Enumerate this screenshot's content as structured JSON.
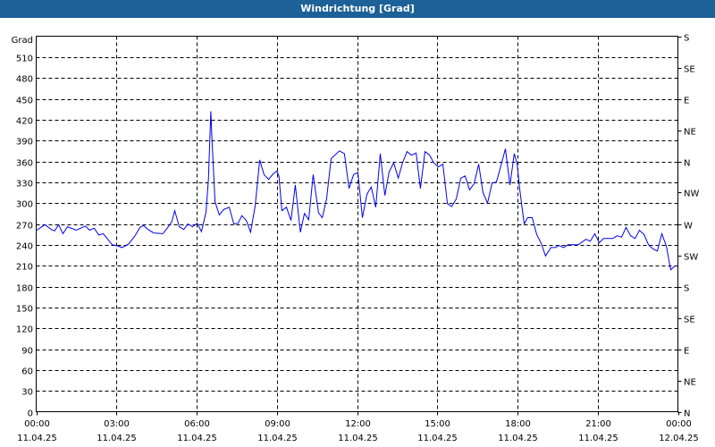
{
  "window": {
    "title": "Windrichtung [Grad]"
  },
  "chart_data": {
    "type": "line",
    "title": "Windrichtung [Grad]",
    "ylabel": "Grad",
    "ylim": [
      0,
      540
    ],
    "yticks": [
      0,
      30,
      60,
      90,
      120,
      150,
      180,
      210,
      240,
      270,
      300,
      330,
      360,
      390,
      420,
      450,
      480,
      510
    ],
    "right_axis": [
      {
        "value": 540,
        "label": "S"
      },
      {
        "value": 495,
        "label": "SE"
      },
      {
        "value": 450,
        "label": "E"
      },
      {
        "value": 405,
        "label": "NE"
      },
      {
        "value": 360,
        "label": "N"
      },
      {
        "value": 315,
        "label": "NW"
      },
      {
        "value": 270,
        "label": "W"
      },
      {
        "value": 225,
        "label": "SW"
      },
      {
        "value": 180,
        "label": "S"
      },
      {
        "value": 135,
        "label": "SE"
      },
      {
        "value": 90,
        "label": "E"
      },
      {
        "value": 45,
        "label": "NE"
      },
      {
        "value": 0,
        "label": "N"
      }
    ],
    "xlim_hours": [
      0,
      24
    ],
    "xticks": [
      {
        "hour": 0,
        "time": "00:00",
        "date": "11.04.25"
      },
      {
        "hour": 3,
        "time": "03:00",
        "date": "11.04.25"
      },
      {
        "hour": 6,
        "time": "06:00",
        "date": "11.04.25"
      },
      {
        "hour": 9,
        "time": "09:00",
        "date": "11.04.25"
      },
      {
        "hour": 12,
        "time": "12:00",
        "date": "11.04.25"
      },
      {
        "hour": 15,
        "time": "15:00",
        "date": "11.04.25"
      },
      {
        "hour": 18,
        "time": "18:00",
        "date": "11.04.25"
      },
      {
        "hour": 21,
        "time": "21:00",
        "date": "11.04.25"
      },
      {
        "hour": 24,
        "time": "00:00",
        "date": "12.04.25"
      }
    ],
    "grid": true,
    "series": [
      {
        "name": "Windrichtung",
        "color": "#0000ee",
        "points": [
          [
            0.02,
            261
          ],
          [
            0.33,
            269
          ],
          [
            0.56,
            262
          ],
          [
            0.69,
            260
          ],
          [
            0.84,
            269
          ],
          [
            1.0,
            256
          ],
          [
            1.17,
            266
          ],
          [
            1.5,
            261
          ],
          [
            1.84,
            267
          ],
          [
            2.0,
            261
          ],
          [
            2.17,
            264
          ],
          [
            2.34,
            254
          ],
          [
            2.51,
            256
          ],
          [
            2.84,
            240
          ],
          [
            3.01,
            239
          ],
          [
            3.21,
            236
          ],
          [
            3.45,
            241
          ],
          [
            3.68,
            252
          ],
          [
            3.88,
            265
          ],
          [
            4.01,
            268
          ],
          [
            4.18,
            262
          ],
          [
            4.4,
            257
          ],
          [
            4.74,
            256
          ],
          [
            4.9,
            264
          ],
          [
            5.07,
            273
          ],
          [
            5.18,
            289
          ],
          [
            5.35,
            266
          ],
          [
            5.52,
            262
          ],
          [
            5.68,
            270
          ],
          [
            5.85,
            266
          ],
          [
            6.02,
            271
          ],
          [
            6.18,
            259
          ],
          [
            6.35,
            287
          ],
          [
            6.44,
            334
          ],
          [
            6.53,
            432
          ],
          [
            6.57,
            394
          ],
          [
            6.69,
            302
          ],
          [
            6.85,
            283
          ],
          [
            7.02,
            291
          ],
          [
            7.22,
            294
          ],
          [
            7.39,
            270
          ],
          [
            7.55,
            271
          ],
          [
            7.69,
            282
          ],
          [
            7.86,
            275
          ],
          [
            8.02,
            258
          ],
          [
            8.19,
            296
          ],
          [
            8.36,
            362
          ],
          [
            8.52,
            341
          ],
          [
            8.69,
            334
          ],
          [
            8.86,
            342
          ],
          [
            9.0,
            346
          ],
          [
            9.08,
            339
          ],
          [
            9.19,
            289
          ],
          [
            9.36,
            294
          ],
          [
            9.53,
            275
          ],
          [
            9.69,
            326
          ],
          [
            9.88,
            258
          ],
          [
            10.03,
            285
          ],
          [
            10.19,
            276
          ],
          [
            10.36,
            341
          ],
          [
            10.56,
            286
          ],
          [
            10.7,
            279
          ],
          [
            10.86,
            306
          ],
          [
            11.03,
            364
          ],
          [
            11.34,
            375
          ],
          [
            11.53,
            371
          ],
          [
            11.7,
            321
          ],
          [
            11.87,
            341
          ],
          [
            12.03,
            344
          ],
          [
            12.2,
            279
          ],
          [
            12.37,
            313
          ],
          [
            12.53,
            323
          ],
          [
            12.7,
            294
          ],
          [
            12.87,
            371
          ],
          [
            13.04,
            311
          ],
          [
            13.2,
            345
          ],
          [
            13.37,
            358
          ],
          [
            13.54,
            336
          ],
          [
            13.7,
            358
          ],
          [
            13.87,
            374
          ],
          [
            14.04,
            369
          ],
          [
            14.21,
            372
          ],
          [
            14.37,
            321
          ],
          [
            14.54,
            374
          ],
          [
            14.71,
            369
          ],
          [
            14.87,
            358
          ],
          [
            15.04,
            352
          ],
          [
            15.21,
            356
          ],
          [
            15.38,
            299
          ],
          [
            15.54,
            295
          ],
          [
            15.71,
            306
          ],
          [
            15.88,
            336
          ],
          [
            16.04,
            339
          ],
          [
            16.21,
            319
          ],
          [
            16.38,
            328
          ],
          [
            16.55,
            356
          ],
          [
            16.71,
            315
          ],
          [
            16.88,
            300
          ],
          [
            17.05,
            329
          ],
          [
            17.21,
            330
          ],
          [
            17.38,
            354
          ],
          [
            17.55,
            378
          ],
          [
            17.72,
            326
          ],
          [
            17.88,
            371
          ],
          [
            17.99,
            356
          ],
          [
            18.08,
            321
          ],
          [
            18.25,
            270
          ],
          [
            18.38,
            279
          ],
          [
            18.55,
            279
          ],
          [
            18.72,
            255
          ],
          [
            18.89,
            242
          ],
          [
            19.05,
            224
          ],
          [
            19.25,
            236
          ],
          [
            19.42,
            236
          ],
          [
            19.55,
            239
          ],
          [
            19.72,
            236
          ],
          [
            19.89,
            240
          ],
          [
            20.28,
            240
          ],
          [
            20.56,
            248
          ],
          [
            20.72,
            245
          ],
          [
            20.89,
            256
          ],
          [
            21.06,
            243
          ],
          [
            21.22,
            249
          ],
          [
            21.56,
            249
          ],
          [
            21.73,
            253
          ],
          [
            21.89,
            251
          ],
          [
            22.06,
            265
          ],
          [
            22.23,
            253
          ],
          [
            22.4,
            249
          ],
          [
            22.56,
            261
          ],
          [
            22.73,
            255
          ],
          [
            22.9,
            240
          ],
          [
            23.07,
            234
          ],
          [
            23.23,
            231
          ],
          [
            23.4,
            256
          ],
          [
            23.57,
            238
          ],
          [
            23.73,
            204
          ],
          [
            23.9,
            210
          ]
        ]
      }
    ]
  }
}
